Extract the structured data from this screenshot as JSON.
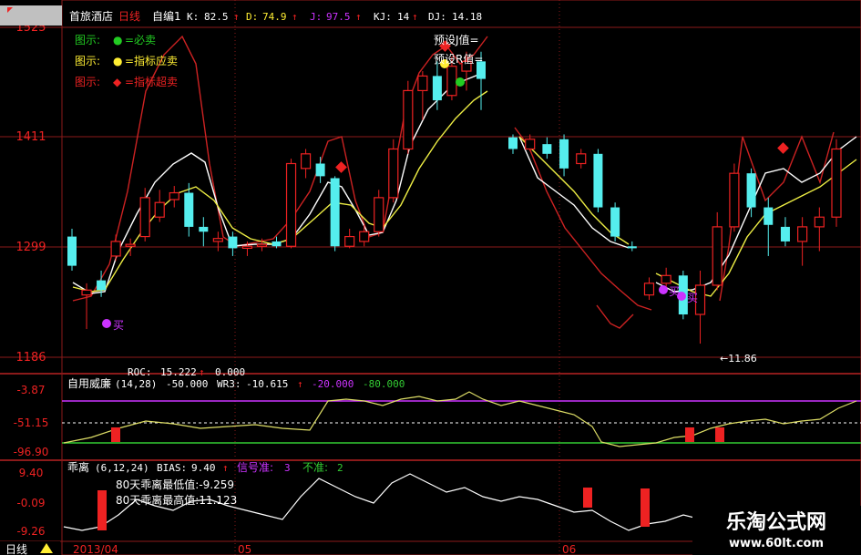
{
  "header": {
    "stock_name": "首旅酒店",
    "period": "日线",
    "indicator_name": "自编1",
    "k_label": "K:",
    "k_value": "82.5",
    "d_label": "D:",
    "d_value": "74.9",
    "j_label": "J:",
    "j_value": "97.5",
    "kj_label": "KJ:",
    "kj_value": "14",
    "dj_label": "DJ:",
    "dj_value": "14.18",
    "up_arrow": "↑"
  },
  "legend": [
    {
      "prefix": "图示:",
      "marker": "●",
      "text": "=必卖",
      "color": "#22cc22"
    },
    {
      "prefix": "图示:",
      "marker": "●",
      "text": "=指标应卖",
      "color": "#ffee33"
    },
    {
      "prefix": "图示:",
      "marker": "◆",
      "text": "=指标超卖",
      "color": "#ee2222"
    }
  ],
  "right_notes": {
    "preset_j": "预设J值=",
    "preset_r": "预设R值="
  },
  "buy_labels": {
    "buy1": "买",
    "buy2": "买",
    "buy3": "买"
  },
  "main_axis": {
    "ticks": [
      "1525",
      "1411",
      "1299",
      "1186"
    ]
  },
  "low_annotation": "←11.86",
  "panel2": {
    "roc_label": "ROC:",
    "roc_value": "15.222",
    "roc_second": "0.000",
    "title": "自用威廉",
    "params": "(14,28)",
    "v1": "-50.000",
    "wr3_label": "WR3:",
    "wr3_value": "-10.615",
    "v3": "-20.000",
    "v4": "-80.000",
    "ticks": [
      "-3.87",
      "-51.15",
      "-96.90"
    ]
  },
  "panel3": {
    "title": "乖离",
    "params": "(6,12,24)",
    "bias_label": "BIAS:",
    "bias_value": "9.40",
    "signal_label": "信号准:",
    "signal_value": "3",
    "inaccurate_label": "不准:",
    "inaccurate_value": "2",
    "min_note": "80天乖离最低值:-9.259",
    "max_note": "80天乖离最高值:11.123",
    "ticks": [
      "9.40",
      "-0.09",
      "-9.26"
    ]
  },
  "footer": {
    "period_tab": "日线",
    "date1": "2013/04",
    "date2": "05",
    "date3": "06"
  },
  "watermark": {
    "title": "乐淘公式网",
    "url": "www.60lt.com"
  },
  "colors": {
    "up": "#ee2222",
    "down": "#55eeee",
    "grid": "#8b1a1a",
    "purple": "#cc33ff",
    "yellow": "#eeee55",
    "green": "#33cc33",
    "white": "#ffffff"
  },
  "chart_data": {
    "type": "candlestick",
    "ylim": [
      1186,
      1525
    ],
    "candles": [
      [
        1310,
        1280,
        1318,
        1275
      ],
      [
        1250,
        1255,
        1262,
        1215
      ],
      [
        1265,
        1255,
        1275,
        1248
      ],
      [
        1290,
        1305,
        1312,
        1285
      ],
      [
        1300,
        1302,
        1308,
        1290
      ],
      [
        1310,
        1350,
        1360,
        1305
      ],
      [
        1330,
        1345,
        1358,
        1325
      ],
      [
        1348,
        1355,
        1362,
        1340
      ],
      [
        1355,
        1320,
        1365,
        1310
      ],
      [
        1320,
        1315,
        1330,
        1300
      ],
      [
        1305,
        1308,
        1315,
        1295
      ],
      [
        1310,
        1298,
        1315,
        1290
      ],
      [
        1298,
        1300,
        1305,
        1290
      ],
      [
        1300,
        1302,
        1308,
        1295
      ],
      [
        1305,
        1300,
        1310,
        1298
      ],
      [
        1300,
        1385,
        1390,
        1298
      ],
      [
        1380,
        1395,
        1400,
        1370
      ],
      [
        1385,
        1372,
        1392,
        1365
      ],
      [
        1370,
        1300,
        1372,
        1295
      ],
      [
        1300,
        1310,
        1318,
        1298
      ],
      [
        1305,
        1315,
        1322,
        1300
      ],
      [
        1315,
        1350,
        1358,
        1310
      ],
      [
        1350,
        1400,
        1410,
        1345
      ],
      [
        1400,
        1460,
        1470,
        1395
      ],
      [
        1460,
        1475,
        1480,
        1430
      ],
      [
        1475,
        1450,
        1490,
        1440
      ],
      [
        1455,
        1485,
        1495,
        1450
      ],
      [
        1480,
        1490,
        1500,
        1460
      ],
      [
        1490,
        1472,
        1500,
        1440
      ],
      [
        1412,
        1400,
        1415,
        1395
      ],
      [
        1400,
        1410,
        1415,
        1398
      ],
      [
        1405,
        1395,
        1412,
        1390
      ],
      [
        1410,
        1380,
        1415,
        1372
      ],
      [
        1385,
        1395,
        1400,
        1380
      ],
      [
        1395,
        1340,
        1400,
        1335
      ],
      [
        1340,
        1310,
        1345,
        1305
      ],
      [
        1300,
        1298,
        1305,
        1295
      ],
      [
        1250,
        1262,
        1268,
        1245
      ],
      [
        1262,
        1270,
        1278,
        1255
      ],
      [
        1270,
        1230,
        1275,
        1225
      ],
      [
        1230,
        1260,
        1275,
        1200
      ],
      [
        1260,
        1320,
        1335,
        1255
      ],
      [
        1320,
        1375,
        1385,
        1315
      ],
      [
        1375,
        1340,
        1380,
        1330
      ],
      [
        1340,
        1322,
        1350,
        1290
      ],
      [
        1320,
        1305,
        1330,
        1300
      ],
      [
        1305,
        1320,
        1330,
        1280
      ],
      [
        1320,
        1330,
        1340,
        1295
      ],
      [
        1330,
        1400,
        1410,
        1320
      ]
    ]
  }
}
